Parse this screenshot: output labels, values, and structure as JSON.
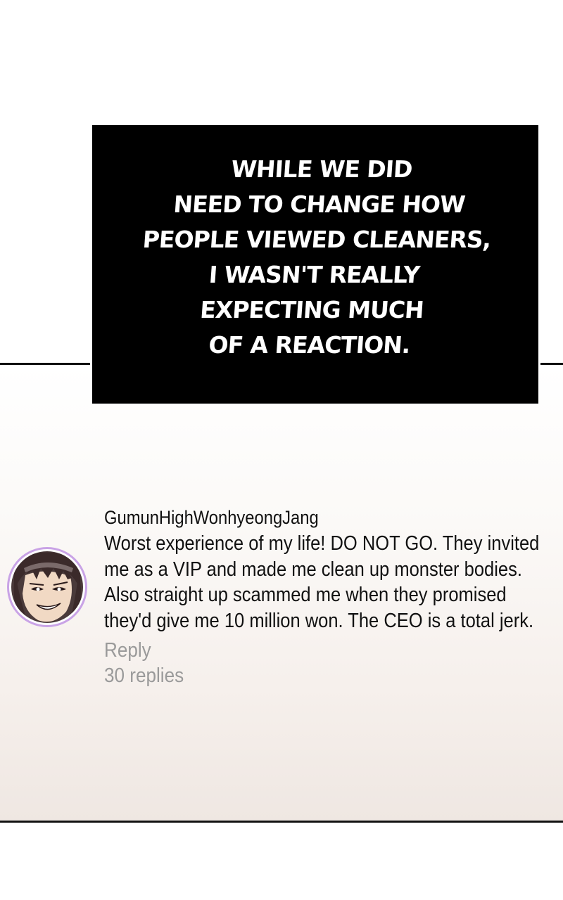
{
  "caption": {
    "lines": [
      "WHILE WE DID",
      "NEED TO CHANGE HOW",
      "PEOPLE VIEWED CLEANERS,",
      "I WASN'T REALLY",
      "EXPECTING MUCH",
      "OF A REACTION."
    ]
  },
  "comment": {
    "username": "GumunHighWonhyeongJang",
    "text": "Worst experience of my life! DO NOT GO. They invited me as a VIP and made me clean up monster bodies. Also straight up scammed me when they promised they'd give me 10 million won. The CEO is a total jerk.",
    "reply_label": "Reply",
    "replies_label": "30 replies"
  },
  "colors": {
    "caption_bg": "#000000",
    "caption_text": "#ffffff",
    "avatar_ring": "#c9a3e6",
    "meta_text": "#9a9a9a"
  },
  "icons": {
    "avatar": "user-avatar-portrait"
  }
}
